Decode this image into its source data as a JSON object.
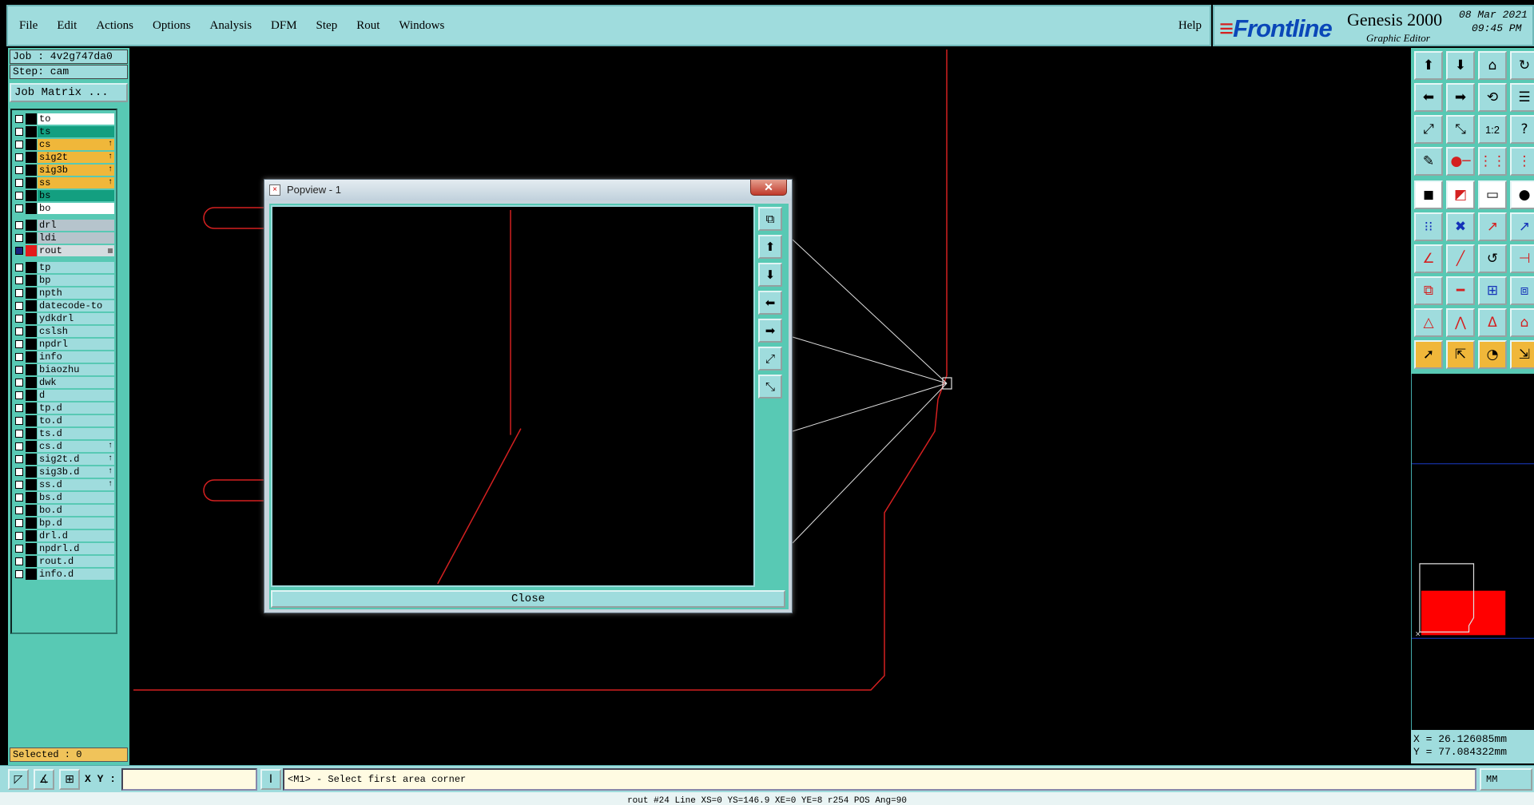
{
  "menubar": {
    "items": [
      "File",
      "Edit",
      "Actions",
      "Options",
      "Analysis",
      "DFM",
      "Step",
      "Rout",
      "Windows"
    ],
    "help": "Help"
  },
  "logo": {
    "brand": "Frontline",
    "app_name": "Genesis 2000",
    "subtitle": "Graphic Editor",
    "date": "08 Mar 2021",
    "time": "09:45 PM"
  },
  "job": {
    "job_line": "Job : 4v2g747da0",
    "step_line": "Step: cam",
    "job_matrix_button": "Job Matrix ..."
  },
  "layers": [
    {
      "name": "to",
      "color": "#ffffff",
      "mark": ""
    },
    {
      "name": "ts",
      "color": "#139f80",
      "mark": ""
    },
    {
      "name": "cs",
      "color": "#f0b73a",
      "mark": "↑"
    },
    {
      "name": "sig2t",
      "color": "#f0b73a",
      "mark": "↑"
    },
    {
      "name": "sig3b",
      "color": "#f0b73a",
      "mark": "↑"
    },
    {
      "name": "ss",
      "color": "#f0b73a",
      "mark": "↑"
    },
    {
      "name": "bs",
      "color": "#139f80",
      "mark": ""
    },
    {
      "name": "bo",
      "color": "#ffffff",
      "mark": ""
    },
    {
      "name": "drl",
      "color": "#b6c4cc",
      "mark": ""
    },
    {
      "name": "ldi",
      "color": "#b6c4cc",
      "mark": ""
    },
    {
      "name": "rout",
      "color": "#d4dce0",
      "mark": "",
      "active": true
    },
    {
      "name": "tp",
      "color": "#9fdcdd",
      "mark": ""
    },
    {
      "name": "bp",
      "color": "#9fdcdd",
      "mark": ""
    },
    {
      "name": "npth",
      "color": "#9fdcdd",
      "mark": ""
    },
    {
      "name": "datecode-to",
      "color": "#9fdcdd",
      "mark": ""
    },
    {
      "name": "ydkdrl",
      "color": "#9fdcdd",
      "mark": ""
    },
    {
      "name": "cslsh",
      "color": "#9fdcdd",
      "mark": ""
    },
    {
      "name": "npdrl",
      "color": "#9fdcdd",
      "mark": ""
    },
    {
      "name": "info",
      "color": "#9fdcdd",
      "mark": ""
    },
    {
      "name": "biaozhu",
      "color": "#9fdcdd",
      "mark": ""
    },
    {
      "name": "dwk",
      "color": "#9fdcdd",
      "mark": ""
    },
    {
      "name": "d",
      "color": "#9fdcdd",
      "mark": ""
    },
    {
      "name": "tp.d",
      "color": "#9fdcdd",
      "mark": ""
    },
    {
      "name": "to.d",
      "color": "#9fdcdd",
      "mark": ""
    },
    {
      "name": "ts.d",
      "color": "#9fdcdd",
      "mark": ""
    },
    {
      "name": "cs.d",
      "color": "#9fdcdd",
      "mark": "↑"
    },
    {
      "name": "sig2t.d",
      "color": "#9fdcdd",
      "mark": "↑"
    },
    {
      "name": "sig3b.d",
      "color": "#9fdcdd",
      "mark": "↑"
    },
    {
      "name": "ss.d",
      "color": "#9fdcdd",
      "mark": "↑"
    },
    {
      "name": "bs.d",
      "color": "#9fdcdd",
      "mark": ""
    },
    {
      "name": "bo.d",
      "color": "#9fdcdd",
      "mark": ""
    },
    {
      "name": "bp.d",
      "color": "#9fdcdd",
      "mark": ""
    },
    {
      "name": "drl.d",
      "color": "#9fdcdd",
      "mark": ""
    },
    {
      "name": "npdrl.d",
      "color": "#9fdcdd",
      "mark": ""
    },
    {
      "name": "rout.d",
      "color": "#9fdcdd",
      "mark": ""
    },
    {
      "name": "info.d",
      "color": "#9fdcdd",
      "mark": ""
    }
  ],
  "selected": "Selected : 0",
  "popview": {
    "title": "Popview - 1",
    "close_x": "✕",
    "close_button": "Close",
    "tool_icons": [
      "zoom-window-icon",
      "pan-up-icon",
      "pan-down-icon",
      "pan-left-icon",
      "pan-right-icon",
      "zoom-in-icon",
      "zoom-out-icon"
    ]
  },
  "right_tools": {
    "group1": [
      "pan-up-icon",
      "pan-down-icon",
      "home-icon",
      "refresh-icon",
      "pan-left-icon",
      "pan-right-icon",
      "rotate-icon",
      "menu-icon",
      "zoom-in-icon",
      "zoom-out-icon",
      "scale-icon",
      "help-icon",
      "measure-icon",
      "snap-icon",
      "net-icon",
      "route-icon"
    ],
    "group2": [
      "select-feature-icon",
      "add-line-icon",
      "ruler-icon",
      "pad-icon",
      "link-icon",
      "cross-icon",
      "move-icon",
      "connect-icon",
      "angle-icon",
      "line-icon",
      "arc-icon",
      "flip-icon",
      "copy-icon",
      "minus-icon",
      "align-icon",
      "group-icon",
      "triangle-icon",
      "peak-icon",
      "fill-icon",
      "polygon-icon",
      "pointer-icon",
      "pointer-box-icon",
      "pointer-circle-icon",
      "pointer-line-icon"
    ],
    "scale_label": "1:2",
    "help_label": "?"
  },
  "coords": {
    "x": "X = 26.126085mm",
    "y": "Y = 77.084322mm"
  },
  "bottom": {
    "xy_label": "X Y :",
    "xy_value": "",
    "prompt": "<M1> - Select first area corner",
    "units": "MM"
  },
  "statusline": "rout #24 Line XS=0 YS=146.9 XE=0 YE=8 r254 POS Ang=90"
}
